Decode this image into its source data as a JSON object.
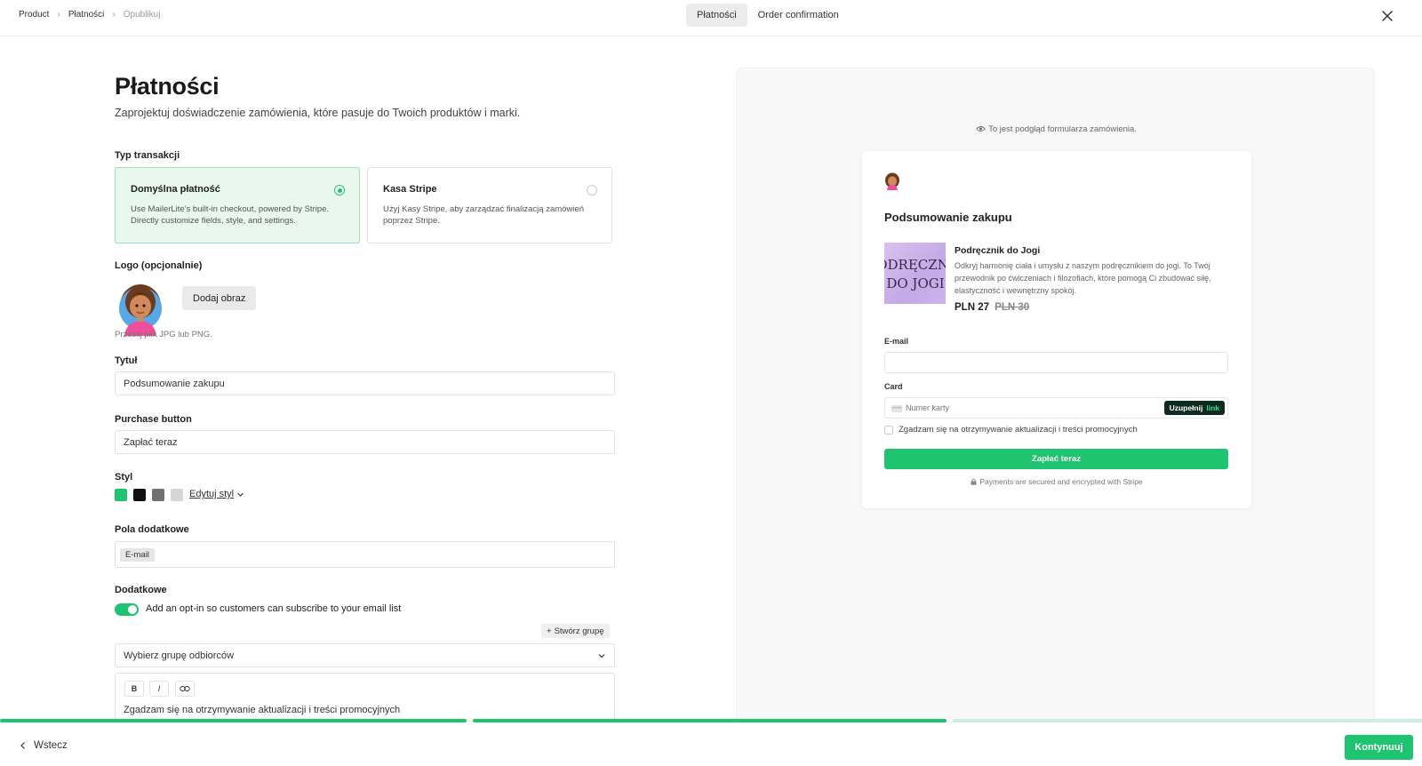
{
  "breadcrumb": {
    "items": [
      "Product",
      "Płatności",
      "Opublikuj"
    ]
  },
  "tabs": [
    {
      "label": "Płatności",
      "active": true
    },
    {
      "label": "Order confirmation",
      "active": false
    }
  ],
  "page": {
    "title": "Płatności",
    "subtitle": "Zaprojektuj doświadczenie zamówienia, które pasuje do Twoich produktów i marki."
  },
  "transaction": {
    "label": "Typ transakcji",
    "options": [
      {
        "title": "Domyślna płatność",
        "line1": "Use MailerLite's built-in checkout, powered by Stripe.",
        "line2": "Directly customize fields, style, and settings.",
        "selected": true
      },
      {
        "title": "Kasa Stripe",
        "line1": "Użyj Kasy Stripe, aby zarządzać finalizacją zamówień",
        "line2": "poprzez Stripe.",
        "selected": false
      }
    ]
  },
  "logo": {
    "label": "Logo (opcjonalnie)",
    "button": "Dodaj obraz",
    "hint": "Prześlij plik JPG lub PNG."
  },
  "title_field": {
    "label": "Tytuł",
    "value": "Podsumowanie zakupu"
  },
  "purchase_button": {
    "label": "Purchase button",
    "value": "Zapłać teraz"
  },
  "style": {
    "label": "Styl",
    "swatches": [
      "#1ec46f",
      "#111111",
      "#707070",
      "#d6d6d6"
    ],
    "edit_link": "Edytuj styl"
  },
  "extra_fields": {
    "label": "Pola dodatkowe",
    "chips": [
      "E-mail"
    ]
  },
  "additional": {
    "label": "Dodatkowe",
    "optin_text": "Add an opt-in so customers can subscribe to your email list",
    "optin_enabled": true,
    "create_group": "Stwórz grupę",
    "group_select": "Wybierz grupę odbiorców",
    "editor_buttons": [
      "B",
      "I",
      "link"
    ],
    "editor_text": "Zgadzam się na otrzymywanie aktualizacji i treści promocyjnych"
  },
  "preview": {
    "note": "To jest podgląd formularza zamówienia.",
    "card_title": "Podsumowanie zakupu",
    "product": {
      "image_text": [
        "ODRĘCZNI",
        "DO JOGI"
      ],
      "name": "Podręcznik do Jogi",
      "description": "Odkryj harmonię ciała i umysłu z naszym podręcznikiem do jogi. To Twój przewodnik po ćwiczeniach i filozofiach, które pomogą Ci zbudować siłę, elastyczność i wewnętrzny spokój.",
      "price": "PLN 27",
      "old_price": "PLN 30"
    },
    "email_label": "E-mail",
    "card_label": "Card",
    "card_placeholder": "Numer karty",
    "autofill_label": "Uzupełnij",
    "autofill_brand": "link",
    "consent": "Zgadzam się na otrzymywanie aktualizacji i treści promocyjnych",
    "pay_button": "Zapłać teraz",
    "secure_note": "Payments are secured and encrypted with Stripe"
  },
  "progress": {
    "steps_completed": 2,
    "steps_total": 3,
    "colors": [
      "#1ec46f",
      "#1ec46f",
      "#cdeedd"
    ]
  },
  "footer": {
    "back": "Wstecz",
    "next": "Kontynuuj"
  }
}
